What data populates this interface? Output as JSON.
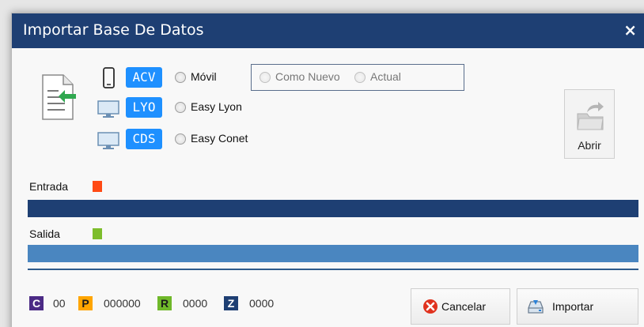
{
  "window": {
    "title": "Importar Base De Datos",
    "close_glyph": "×"
  },
  "sources": [
    {
      "device_icon": "phone-icon",
      "code": "ACV",
      "label": "Móvil"
    },
    {
      "device_icon": "monitor-icon",
      "code": "LYO",
      "label": "Easy Lyon"
    },
    {
      "device_icon": "monitor-icon",
      "code": "CDS",
      "label": "Easy Conet"
    }
  ],
  "mode": {
    "option_1": "Como Nuevo",
    "option_2": "Actual"
  },
  "open_button": {
    "label": "Abrir",
    "icon": "folder-open-icon"
  },
  "entrada": {
    "label": "Entrada",
    "marker": ".",
    "color": "#ff4a14",
    "bar_color": "#1e3f73",
    "progress": 1.0
  },
  "salida": {
    "label": "Salida",
    "marker": ".",
    "color": "#7dbd2c",
    "bar_color": "#4a86c0",
    "progress": 1.0
  },
  "counters": [
    {
      "tag": "C",
      "value": "00",
      "bg": "#4b2a85",
      "fg": "#ffffff"
    },
    {
      "tag": "P",
      "value": "000000",
      "bg": "#ffa500",
      "fg": "#1a1a1a"
    },
    {
      "tag": "R",
      "value": "0000",
      "bg": "#6fb82a",
      "fg": "#1a1a1a"
    },
    {
      "tag": "Z",
      "value": "0000",
      "bg": "#1e3f73",
      "fg": "#ffffff"
    }
  ],
  "buttons": {
    "cancel_label": "Cancelar",
    "import_label": "Importar"
  },
  "colors": {
    "title_bar": "#1e3f73",
    "badge": "#1e90ff",
    "cancel_icon": "#e0321e"
  }
}
